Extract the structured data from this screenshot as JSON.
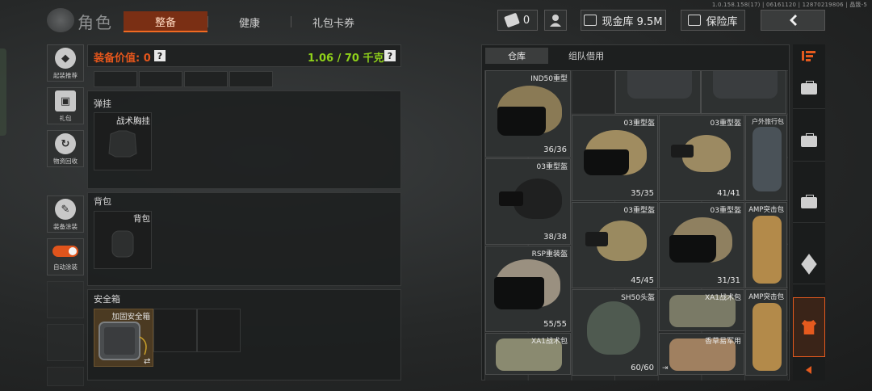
{
  "version": "1.0.158.158(17) | 06161120 | 12870219806 | 晶簇-5",
  "header": {
    "title": "角色",
    "tabs": [
      "整备",
      "健康",
      "礼包卡券"
    ],
    "tickets": "0",
    "cash_label": "现金库 9.5M",
    "vault_label": "保险库"
  },
  "side_menu": {
    "items": [
      "起装推荐",
      "礼包",
      "物资回收",
      "装备涂装",
      "自动涂装"
    ]
  },
  "loadout": {
    "value_label": "装备价值: 0",
    "help": "?",
    "weight": "1.06 / 70 千克",
    "rig_title": "弹挂",
    "rig_item": "战术胸挂",
    "backpack_title": "背包",
    "backpack_item": "背包",
    "safebox_title": "安全箱",
    "safebox_item": "加固安全箱",
    "safebox_swap": "⇄"
  },
  "inventory": {
    "tabs": [
      "仓库",
      "组队借用"
    ],
    "items": [
      {
        "name": "IND50重型",
        "dur": "36/36"
      },
      {
        "name": "03重型盔",
        "dur": "35/35"
      },
      {
        "name": "03重型盔",
        "dur": "41/41"
      },
      {
        "name": "户外旅行包",
        "dur": ""
      },
      {
        "name": "03重型盔",
        "dur": "38/38"
      },
      {
        "name": "03重型盔",
        "dur": "45/45"
      },
      {
        "name": "03重型盔",
        "dur": "31/31"
      },
      {
        "name": "AMP突击包",
        "dur": ""
      },
      {
        "name": "RSP重装盔",
        "dur": "55/55"
      },
      {
        "name": "SH50头盔",
        "dur": "60/60"
      },
      {
        "name": "XA1战术包",
        "dur": ""
      },
      {
        "name": "AMP突击包",
        "dur": ""
      },
      {
        "name": "XA1战术包",
        "dur": ""
      },
      {
        "name": "香草易军用",
        "dur": ""
      }
    ]
  },
  "colors": {
    "accent": "#e5561c",
    "weight_green": "#8fd11a"
  }
}
